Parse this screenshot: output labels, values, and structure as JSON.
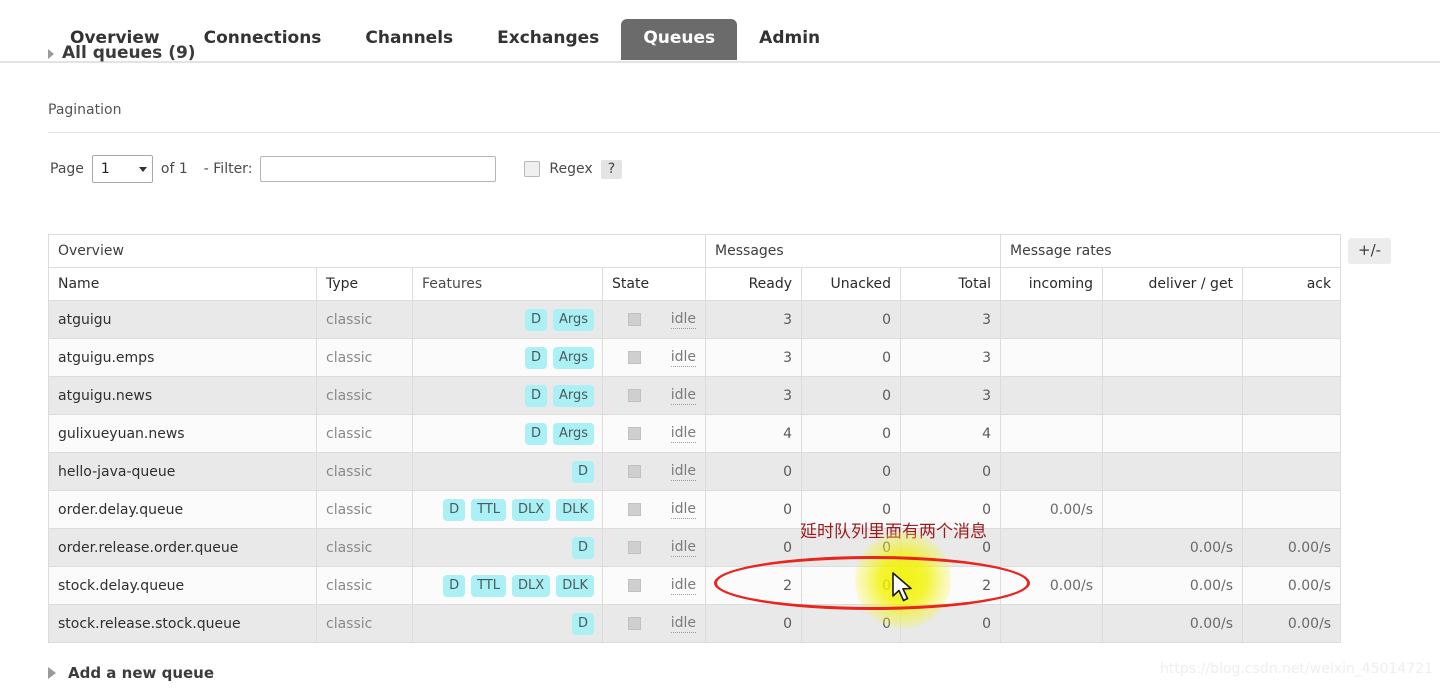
{
  "nav": {
    "tabs": [
      {
        "label": "Overview",
        "active": false
      },
      {
        "label": "Connections",
        "active": false
      },
      {
        "label": "Channels",
        "active": false
      },
      {
        "label": "Exchanges",
        "active": false
      },
      {
        "label": "Queues",
        "active": true
      },
      {
        "label": "Admin",
        "active": false
      }
    ],
    "active_tab_bg": "#6b6b6b"
  },
  "heading": {
    "all_queues": "All queues (9)"
  },
  "pagination": {
    "title": "Pagination",
    "page_label": "Page",
    "page_value": "1",
    "of_label": "of 1",
    "filter_label": "- Filter:",
    "filter_value": "",
    "filter_placeholder": "",
    "regex_label": "Regex",
    "help_label": "?"
  },
  "table": {
    "group_headers": [
      {
        "label": "Overview",
        "span": 4
      },
      {
        "label": "Messages",
        "span": 3
      },
      {
        "label": "Message rates",
        "span": 3
      }
    ],
    "columns": [
      {
        "label": "Name",
        "bold": true,
        "align": "left"
      },
      {
        "label": "Type",
        "bold": true,
        "align": "left"
      },
      {
        "label": "Features",
        "bold": false,
        "align": "left"
      },
      {
        "label": "State",
        "bold": true,
        "align": "left"
      },
      {
        "label": "Ready",
        "bold": true,
        "align": "right"
      },
      {
        "label": "Unacked",
        "bold": true,
        "align": "right"
      },
      {
        "label": "Total",
        "bold": true,
        "align": "right"
      },
      {
        "label": "incoming",
        "bold": true,
        "align": "right"
      },
      {
        "label": "deliver / get",
        "bold": true,
        "align": "right"
      },
      {
        "label": "ack",
        "bold": true,
        "align": "right"
      }
    ],
    "toggle_columns_label": "+/-",
    "feature_tag_color": "#aaf0f5",
    "rows": [
      {
        "name": "atguigu",
        "type": "classic",
        "features": [
          "D",
          "Args"
        ],
        "state": "idle",
        "ready": "3",
        "unacked": "0",
        "total": "3",
        "incoming": "",
        "deliver_get": "",
        "ack": ""
      },
      {
        "name": "atguigu.emps",
        "type": "classic",
        "features": [
          "D",
          "Args"
        ],
        "state": "idle",
        "ready": "3",
        "unacked": "0",
        "total": "3",
        "incoming": "",
        "deliver_get": "",
        "ack": ""
      },
      {
        "name": "atguigu.news",
        "type": "classic",
        "features": [
          "D",
          "Args"
        ],
        "state": "idle",
        "ready": "3",
        "unacked": "0",
        "total": "3",
        "incoming": "",
        "deliver_get": "",
        "ack": ""
      },
      {
        "name": "gulixueyuan.news",
        "type": "classic",
        "features": [
          "D",
          "Args"
        ],
        "state": "idle",
        "ready": "4",
        "unacked": "0",
        "total": "4",
        "incoming": "",
        "deliver_get": "",
        "ack": ""
      },
      {
        "name": "hello-java-queue",
        "type": "classic",
        "features": [
          "D"
        ],
        "state": "idle",
        "ready": "0",
        "unacked": "0",
        "total": "0",
        "incoming": "",
        "deliver_get": "",
        "ack": ""
      },
      {
        "name": "order.delay.queue",
        "type": "classic",
        "features": [
          "D",
          "TTL",
          "DLX",
          "DLK"
        ],
        "state": "idle",
        "ready": "0",
        "unacked": "0",
        "total": "0",
        "incoming": "0.00/s",
        "deliver_get": "",
        "ack": ""
      },
      {
        "name": "order.release.order.queue",
        "type": "classic",
        "features": [
          "D"
        ],
        "state": "idle",
        "ready": "0",
        "unacked": "0",
        "total": "0",
        "incoming": "",
        "deliver_get": "0.00/s",
        "ack": "0.00/s"
      },
      {
        "name": "stock.delay.queue",
        "type": "classic",
        "features": [
          "D",
          "TTL",
          "DLX",
          "DLK"
        ],
        "state": "idle",
        "ready": "2",
        "unacked": "0",
        "total": "2",
        "incoming": "0.00/s",
        "deliver_get": "0.00/s",
        "ack": "0.00/s"
      },
      {
        "name": "stock.release.stock.queue",
        "type": "classic",
        "features": [
          "D"
        ],
        "state": "idle",
        "ready": "0",
        "unacked": "0",
        "total": "0",
        "incoming": "",
        "deliver_get": "0.00/s",
        "ack": "0.00/s"
      }
    ]
  },
  "add_queue": {
    "label": "Add a new queue"
  },
  "annotations": {
    "note_text": "延时队列里面有两个消息",
    "note_color": "#9c1c1c",
    "ellipse_color": "#e8251f",
    "highlight_color": "#f2f200"
  },
  "watermark": {
    "text": "https://blog.csdn.net/weixin_45014721"
  }
}
